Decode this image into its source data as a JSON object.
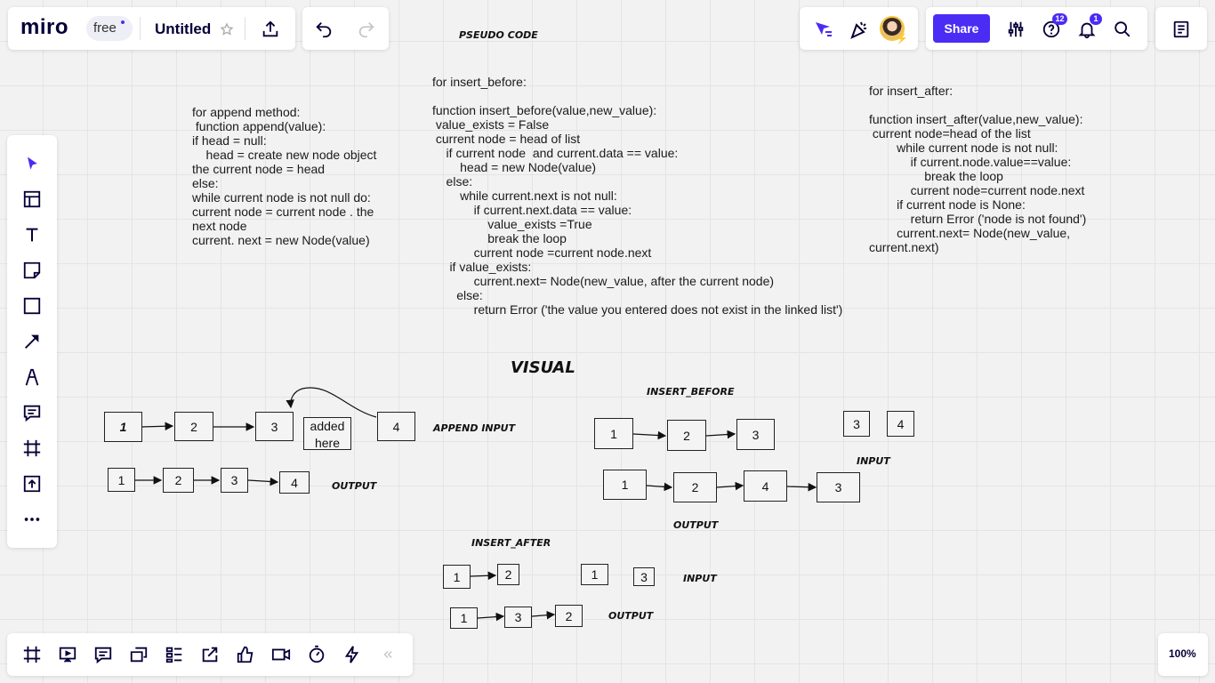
{
  "header": {
    "logo": "miro",
    "plan": "free",
    "board_title": "Untitled",
    "share_label": "Share",
    "help_badge": "12",
    "notifications_badge": "1",
    "accent_color": "#4b2cf5"
  },
  "icons": {
    "left_toolbar": [
      "select-icon",
      "templates-icon",
      "text-icon",
      "sticky-note-icon",
      "shape-icon",
      "arrow-icon",
      "pen-icon",
      "comment-icon",
      "frame-icon",
      "upload-icon",
      "more-icon"
    ],
    "bottom_toolbar": [
      "frames-icon",
      "present-icon",
      "comments-icon",
      "cards-icon",
      "kanban-icon",
      "share-screen-icon",
      "voting-icon",
      "video-icon",
      "timer-icon",
      "lightning-icon",
      "collapse-icon"
    ]
  },
  "zoom": "100%",
  "canvas": {
    "pseudo_code_title": "PSEUDO CODE",
    "append_code": "for append method:\n function append(value):\nif head = null:\n    head = create new node object\nthe current node = head\nelse:\nwhile current node is not null do:\ncurrent node = current node . the\nnext node\ncurrent. next = new Node(value)",
    "insert_before_code": "for insert_before:\n\nfunction insert_before(value,new_value):\n value_exists = False\n current node = head of list\n    if current node  and current.data == value:\n        head = new Node(value)\n    else:\n        while current.next is not null:\n            if current.next.data == value:\n                value_exists =True\n                break the loop\n            current node =current node.next\n     if value_exists:\n            current.next= Node(new_value, after the current node)\n       else:\n            return Error ('the value you entered does not exist in the linked list')",
    "insert_after_code": "for insert_after:\n\nfunction insert_after(value,new_value):\n current node=head of the list\n        while current node is not null:\n            if current.node.value==value:\n                break the loop\n            current node=current node.next\n        if current node is None:\n            return Error ('node is not found')\n        current.next= Node(new_value,\ncurrent.next)",
    "visual_title": "VISUAL",
    "append_input_label": "APPEND INPUT",
    "append_output_label": "OUTPUT",
    "append_input_nodes": [
      "1",
      "2",
      "3",
      "4"
    ],
    "append_added_label": "added here",
    "append_output_nodes": [
      "1",
      "2",
      "3",
      "4"
    ],
    "insert_before_title": "INSERT_BEFORE",
    "insert_before_list": [
      "1",
      "2",
      "3"
    ],
    "insert_before_input_nodes": [
      "3",
      "4"
    ],
    "insert_before_input_label": "INPUT",
    "insert_before_output_nodes": [
      "1",
      "2",
      "4",
      "3"
    ],
    "insert_before_output_label": "OUTPUT",
    "insert_after_title": "INSERT_AFTER",
    "insert_after_list": [
      "1",
      "2"
    ],
    "insert_after_input_nodes": [
      "1",
      "3"
    ],
    "insert_after_input_label": "INPUT",
    "insert_after_output_nodes": [
      "1",
      "3",
      "2"
    ],
    "insert_after_output_label": "OUTPUT"
  }
}
